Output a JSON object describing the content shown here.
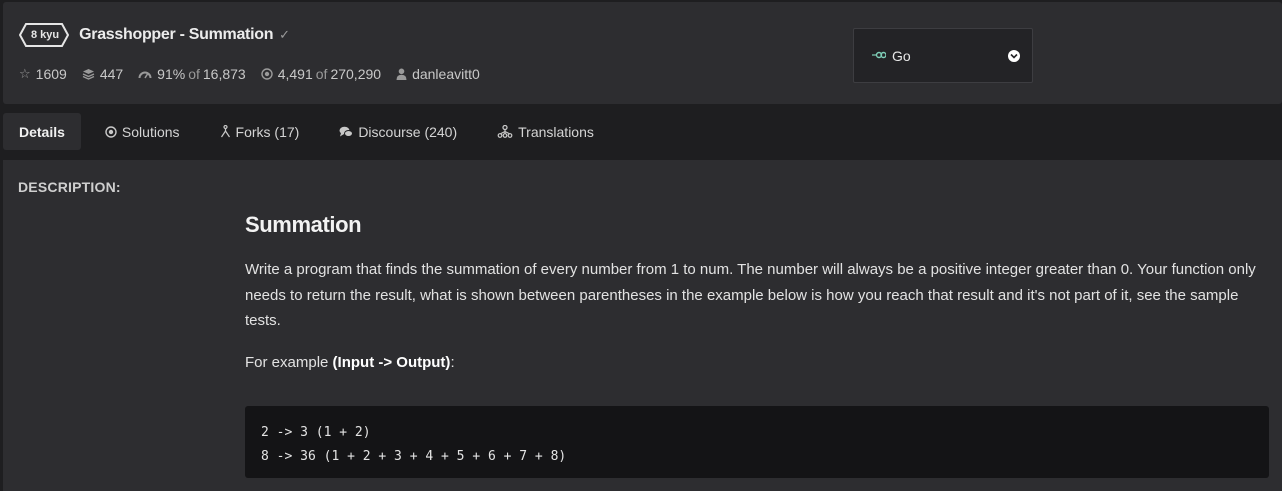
{
  "header": {
    "kyu": "8 kyu",
    "title": "Grasshopper - Summation",
    "approved_icon": "check-icon",
    "stats": {
      "stars": "1609",
      "collections": "447",
      "satisfaction": "91%",
      "satisfaction_of": "of",
      "satisfaction_total": "16,873",
      "completed": "4,491",
      "completed_of": "of",
      "completed_total": "270,290",
      "author": "danleavitt0"
    }
  },
  "language_select": {
    "icon": "go-gopher-icon",
    "selected": "Go"
  },
  "tabs": [
    {
      "label": "Details",
      "icon": "",
      "active": true
    },
    {
      "label": "Solutions",
      "icon": "target-icon"
    },
    {
      "label": "Forks (17)",
      "icon": "fork-icon"
    },
    {
      "label": "Discourse (240)",
      "icon": "comments-icon"
    },
    {
      "label": "Translations",
      "icon": "translations-icon"
    }
  ],
  "description": {
    "label": "DESCRIPTION:",
    "heading": "Summation",
    "paragraph": "Write a program that finds the summation of every number from 1 to num. The number will always be a positive integer greater than 0. Your function only needs to return the result, what is shown between parentheses in the example below is how you reach that result and it's not part of it, see the sample tests.",
    "example_prefix": "For example ",
    "example_bold": "(Input -> Output)",
    "example_suffix": ":",
    "code_lines": [
      "2 -> 3 (1 + 2)",
      "8 -> 36 (1 + 2 + 3 + 4 + 5 + 6 + 7 + 8)"
    ]
  },
  "colors": {
    "background": "#1e1e20",
    "panel": "#2d2d30",
    "code_bg": "#141416",
    "go_accent": "#7fcfb8"
  }
}
